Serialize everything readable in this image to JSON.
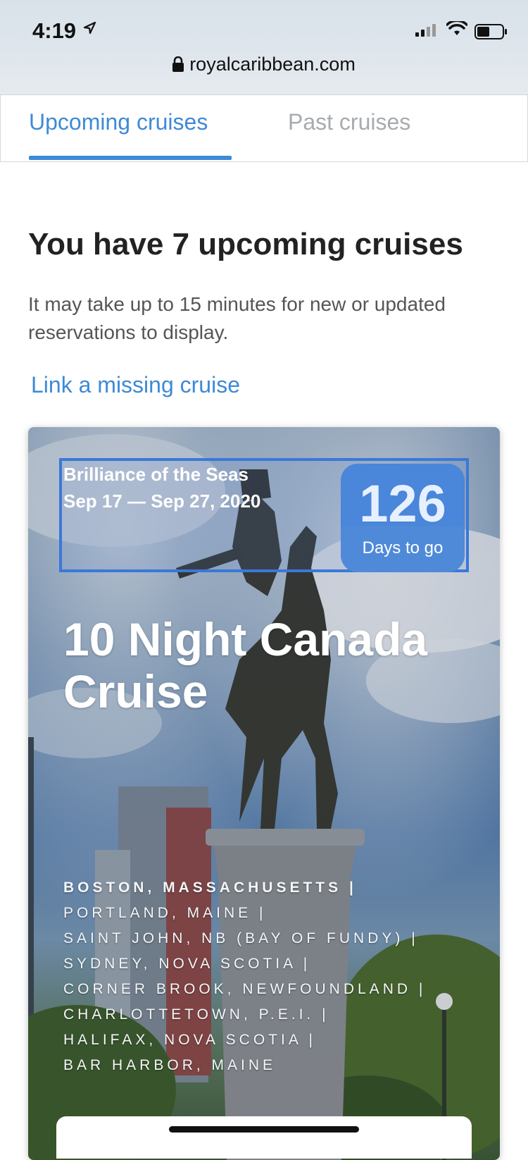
{
  "status_bar": {
    "time": "4:19"
  },
  "browser": {
    "url": "royalcaribbean.com"
  },
  "tabs": [
    {
      "label": "Upcoming cruises",
      "active": true
    },
    {
      "label": "Past cruises",
      "active": false
    }
  ],
  "header": {
    "title": "You have 7 upcoming cruises",
    "subtitle": "It may take up to 15 minutes for new or updated reservations to display.",
    "link": "Link a missing cruise"
  },
  "cruise": {
    "ship": "Brilliance of the Seas",
    "dates": "Sep 17 — Sep 27, 2020",
    "days_count": "126",
    "days_label": "Days to go",
    "title": "10 Night Canada Cruise",
    "ports": [
      "BOSTON, MASSACHUSETTS |",
      "PORTLAND, MAINE |",
      "SAINT JOHN, NB (BAY OF FUNDY) |",
      "SYDNEY, NOVA SCOTIA |",
      "CORNER BROOK, NEWFOUNDLAND |",
      "CHARLOTTETOWN, P.E.I. |",
      "HALIFAX, NOVA SCOTIA |",
      "BAR HARBOR, MAINE"
    ]
  },
  "colors": {
    "accent": "#3e8ad6",
    "badge": "#4f8ad8",
    "tab_inactive": "#a7abaf"
  }
}
